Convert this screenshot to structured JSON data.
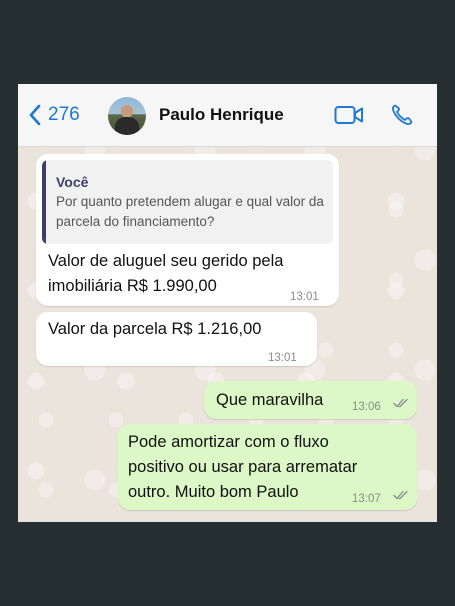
{
  "header": {
    "back_count": "276",
    "contact_name": "Paulo Henrique"
  },
  "messages": [
    {
      "direction": "incoming",
      "quote_author": "Você",
      "quote_text": "Por quanto pretendem alugar e qual valor da parcela do financiamento?",
      "text_line1": "Valor de aluguel seu gerido pela",
      "text_line2": "imobiliária R$ 1.990,00",
      "time": "13:01"
    },
    {
      "direction": "incoming",
      "text": "Valor da parcela R$ 1.216,00",
      "time": "13:01"
    },
    {
      "direction": "outgoing",
      "text": "Que maravilha",
      "time": "13:06",
      "status": "read"
    },
    {
      "direction": "outgoing",
      "text_line1": "Pode amortizar com o fluxo",
      "text_line2": "positivo ou usar para arrematar",
      "text_line3": "outro. Muito bom Paulo",
      "time": "13:07",
      "status": "read"
    }
  ],
  "colors": {
    "header_bg": "#f6f6f6",
    "accent_blue": "#1e78d4",
    "incoming_bubble": "#ffffff",
    "outgoing_bubble": "#dcf8c6",
    "chat_bg": "#ebe4dc",
    "page_bg": "#252f31"
  },
  "icons": [
    "chevron-left-icon",
    "video-call-icon",
    "phone-call-icon",
    "double-check-icon"
  ]
}
